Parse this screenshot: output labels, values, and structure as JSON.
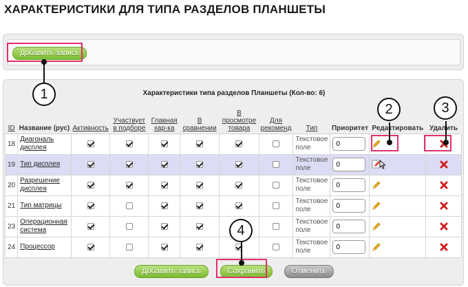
{
  "page": {
    "title": "ХАРАКТЕРИСТИКИ ДЛЯ ТИПА РАЗДЕЛОВ ПЛАНШЕТЫ"
  },
  "top_toolbar": {
    "add_label": "Добавить запись"
  },
  "table": {
    "caption": "Характеристики типа разделов Планшеты (Кол-во: 6)",
    "headers": {
      "id": "ID",
      "name": "Название (рус)",
      "active": "Активность",
      "in_selection": "Участвует в подборе",
      "main_char": "Главная хар-ка",
      "in_compare": "В сравнении",
      "in_view": "В просмотре товара",
      "for_recommend": "Для рекоменд",
      "type": "Тип",
      "priority": "Приоритет",
      "edit": "Редактировать",
      "delete": "Удалить"
    },
    "rows": [
      {
        "id": "18",
        "name": "Диагональ дисплея",
        "type": "Текстовое поле",
        "priority": "0",
        "active": true,
        "in_selection": true,
        "main_char": true,
        "in_compare": true,
        "in_view": true,
        "for_recommend": false
      },
      {
        "id": "19",
        "name": "Тип дисплея",
        "type": "Текстовое поле",
        "priority": "0",
        "active": true,
        "in_selection": true,
        "main_char": true,
        "in_compare": true,
        "in_view": true,
        "for_recommend": false
      },
      {
        "id": "20",
        "name": "Разрешение дисплея",
        "type": "Текстовое поле",
        "priority": "0",
        "active": true,
        "in_selection": true,
        "main_char": true,
        "in_compare": true,
        "in_view": true,
        "for_recommend": false
      },
      {
        "id": "21",
        "name": "Тип матрицы",
        "type": "Текстовое поле",
        "priority": "0",
        "active": true,
        "in_selection": false,
        "main_char": true,
        "in_compare": true,
        "in_view": true,
        "for_recommend": false
      },
      {
        "id": "23",
        "name": "Операционная система",
        "type": "Текстовое поле",
        "priority": "0",
        "active": true,
        "in_selection": false,
        "main_char": true,
        "in_compare": true,
        "in_view": true,
        "for_recommend": false
      },
      {
        "id": "24",
        "name": "Процессор",
        "type": "Текстовое поле",
        "priority": "0",
        "active": true,
        "in_selection": false,
        "main_char": true,
        "in_compare": true,
        "in_view": true,
        "for_recommend": false
      }
    ]
  },
  "bottom_toolbar": {
    "add_label": "Добавить запись",
    "save_label": "Сохранить",
    "cancel_label": "Отменить"
  },
  "callouts": [
    "1",
    "2",
    "3",
    "4"
  ],
  "colors": {
    "highlight": "#e0306a",
    "hover_row": "#dcdcf4",
    "button_green": "#7cba2f"
  }
}
